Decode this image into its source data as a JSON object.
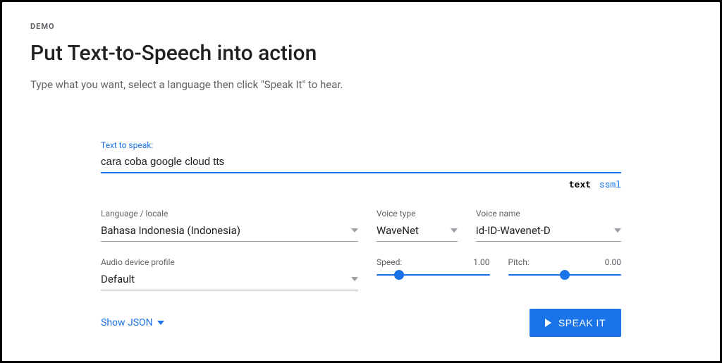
{
  "header": {
    "demo_label": "DEMO",
    "title": "Put Text-to-Speech into action",
    "subtitle": "Type what you want, select a language then click \"Speak It\" to hear."
  },
  "text_input": {
    "label": "Text to speak:",
    "value": "cara coba google cloud tts"
  },
  "format_tabs": {
    "text": "text",
    "ssml": "ssml"
  },
  "language": {
    "label": "Language / locale",
    "value": "Bahasa Indonesia (Indonesia)"
  },
  "voice_type": {
    "label": "Voice type",
    "value": "WaveNet"
  },
  "voice_name": {
    "label": "Voice name",
    "value": "id-ID-Wavenet-D"
  },
  "audio_profile": {
    "label": "Audio device profile",
    "value": "Default"
  },
  "speed": {
    "label": "Speed:",
    "value": "1.00",
    "percent": 20
  },
  "pitch": {
    "label": "Pitch:",
    "value": "0.00",
    "percent": 50
  },
  "actions": {
    "show_json": "Show JSON",
    "speak_it": "SPEAK IT"
  }
}
